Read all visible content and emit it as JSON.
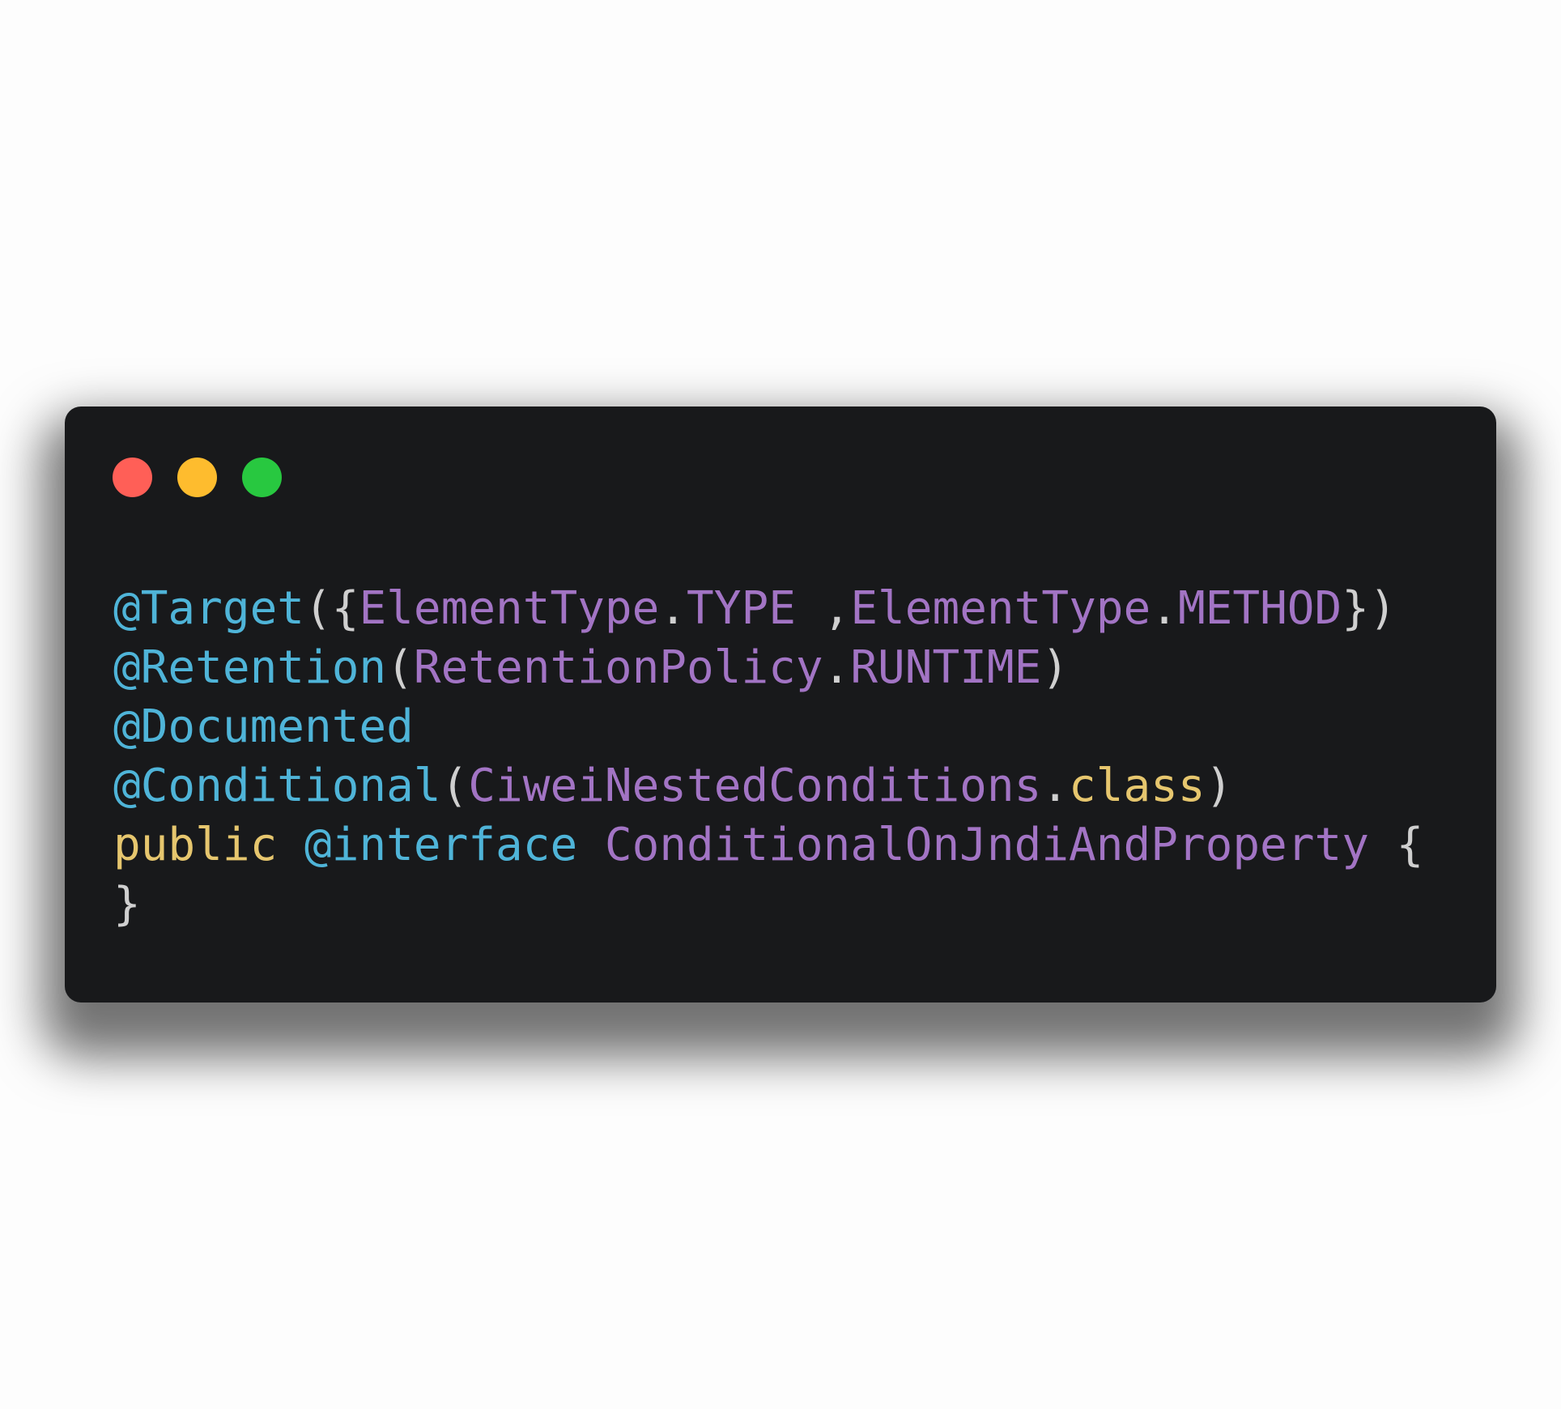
{
  "window_controls": {
    "close_color": "#ff5f57",
    "minimize_color": "#febc2e",
    "maximize_color": "#28c840"
  },
  "colors": {
    "annotation": "#4fb4d8",
    "type": "#a274c4",
    "keyword": "#e6c66e",
    "punctuation": "#cfcfcf",
    "background": "#18191b"
  },
  "code": {
    "lines": [
      [
        {
          "t": "@Target",
          "c": "annotation"
        },
        {
          "t": "({",
          "c": "punctuation"
        },
        {
          "t": "ElementType",
          "c": "type"
        },
        {
          "t": ".",
          "c": "punctuation"
        },
        {
          "t": "TYPE",
          "c": "type"
        },
        {
          "t": " ,",
          "c": "punctuation"
        },
        {
          "t": "ElementType",
          "c": "type"
        },
        {
          "t": ".",
          "c": "punctuation"
        },
        {
          "t": "METHOD",
          "c": "type"
        },
        {
          "t": "})",
          "c": "punctuation"
        }
      ],
      [
        {
          "t": "@Retention",
          "c": "annotation"
        },
        {
          "t": "(",
          "c": "punctuation"
        },
        {
          "t": "RetentionPolicy",
          "c": "type"
        },
        {
          "t": ".",
          "c": "punctuation"
        },
        {
          "t": "RUNTIME",
          "c": "type"
        },
        {
          "t": ")",
          "c": "punctuation"
        }
      ],
      [
        {
          "t": "@Documented",
          "c": "annotation"
        }
      ],
      [
        {
          "t": "@Conditional",
          "c": "annotation"
        },
        {
          "t": "(",
          "c": "punctuation"
        },
        {
          "t": "CiweiNestedConditions",
          "c": "type"
        },
        {
          "t": ".",
          "c": "punctuation"
        },
        {
          "t": "class",
          "c": "keyword"
        },
        {
          "t": ")",
          "c": "punctuation"
        }
      ],
      [
        {
          "t": "public",
          "c": "keyword"
        },
        {
          "t": " ",
          "c": "punctuation"
        },
        {
          "t": "@interface",
          "c": "annotation"
        },
        {
          "t": " ",
          "c": "punctuation"
        },
        {
          "t": "ConditionalOnJndiAndProperty",
          "c": "type"
        },
        {
          "t": " {",
          "c": "punctuation"
        }
      ],
      [
        {
          "t": "}",
          "c": "punctuation"
        }
      ]
    ]
  }
}
